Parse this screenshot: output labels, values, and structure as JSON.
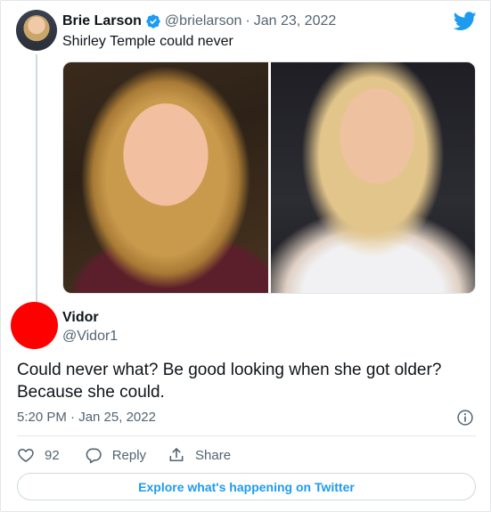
{
  "colors": {
    "brand": "#1d9bf0",
    "text": "#0f1419",
    "muted": "#536471",
    "border": "#e3e6e8",
    "reply_avatar": "#ff0000"
  },
  "parent_tweet": {
    "author_name": "Brie Larson",
    "verified_icon": "verified-badge-icon",
    "handle": "@brielarson",
    "separator": "·",
    "date": "Jan 23, 2022",
    "text": "Shirley Temple could never",
    "logo_icon": "twitter-bird-icon"
  },
  "reply_tweet": {
    "author_name": "Vidor",
    "handle": "@Vidor1",
    "text": "Could never what?  Be good looking when she got older? Because she could.",
    "timestamp": "5:20 PM · Jan 25, 2022",
    "info_icon": "info-icon"
  },
  "actions": {
    "like_count": "92",
    "reply_label": "Reply",
    "share_label": "Share"
  },
  "explore_label": "Explore what's happening on Twitter"
}
